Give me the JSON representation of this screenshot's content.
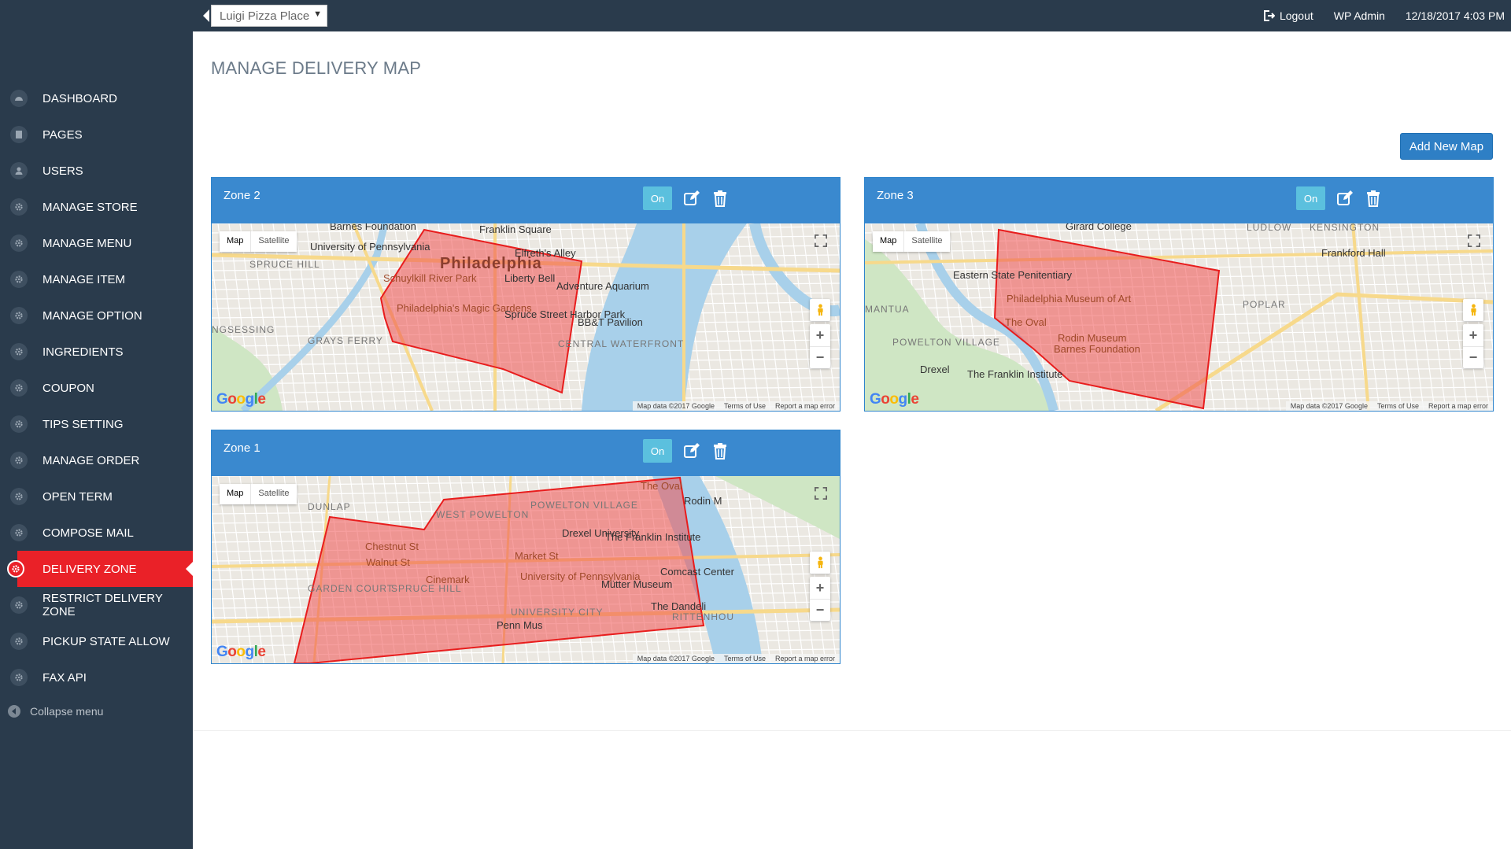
{
  "topbar": {
    "store_select": "Luigi Pizza Place",
    "logout": "Logout",
    "user": "WP Admin",
    "datetime": "12/18/2017 4:03 PM"
  },
  "sidebar": {
    "items": [
      {
        "label": "DASHBOARD",
        "icon": "dashboard-icon"
      },
      {
        "label": "PAGES",
        "icon": "pages-icon"
      },
      {
        "label": "USERS",
        "icon": "user-icon"
      },
      {
        "label": "MANAGE STORE",
        "icon": "gear-icon"
      },
      {
        "label": "MANAGE MENU",
        "icon": "gear-icon"
      },
      {
        "label": "MANAGE ITEM",
        "icon": "gear-icon"
      },
      {
        "label": "MANAGE OPTION",
        "icon": "gear-icon"
      },
      {
        "label": "INGREDIENTS",
        "icon": "gear-icon"
      },
      {
        "label": "COUPON",
        "icon": "gear-icon"
      },
      {
        "label": "TIPS SETTING",
        "icon": "gear-icon"
      },
      {
        "label": "MANAGE ORDER",
        "icon": "gear-icon"
      },
      {
        "label": "OPEN TERM",
        "icon": "gear-icon"
      },
      {
        "label": "COMPOSE MAIL",
        "icon": "gear-icon"
      },
      {
        "label": "DELIVERY ZONE",
        "icon": "gear-icon",
        "active": true
      },
      {
        "label": "RESTRICT DELIVERY ZONE",
        "icon": "gear-icon"
      },
      {
        "label": "PICKUP STATE ALLOW",
        "icon": "gear-icon"
      },
      {
        "label": "FAX API",
        "icon": "gear-icon"
      }
    ],
    "collapse_label": "Collapse menu"
  },
  "main": {
    "title": "MANAGE DELIVERY MAP",
    "add_button": "Add New Map"
  },
  "map_common": {
    "map_btn": "Map",
    "satellite_btn": "Satellite",
    "map_data": "Map data ©2017 Google",
    "terms": "Terms of Use",
    "report": "Report a map error",
    "zoom_in": "+",
    "zoom_out": "−"
  },
  "zones": [
    {
      "title": "Zone 2",
      "status": "On",
      "labels": {
        "city": "Philadelphia",
        "upenn": "University of Pennsylvania",
        "spruce_hill": "SPRUCE HILL",
        "schuylkill": "Schuylkill River Park",
        "magic": "Philadelphia's Magic Gardens",
        "liberty": "Liberty Bell",
        "elfreth": "Elfreth's Alley",
        "franklin": "Franklin Square",
        "aquarium": "Adventure Aquarium",
        "spruce_harbor": "Spruce Street Harbor Park",
        "bbt": "BB&T Pavilion",
        "central": "CENTRAL WATERFRONT",
        "grays": "GRAYS FERRY",
        "kingsessing": "NGSESSING",
        "barnes": "Barnes Foundation"
      }
    },
    {
      "title": "Zone 3",
      "status": "On",
      "labels": {
        "girard": "Girard College",
        "ludlow": "LUDLOW",
        "kensington": "KENSINGTON",
        "eastern": "Eastern State Penitentiary",
        "museum": "Philadelphia Museum of Art",
        "oval": "The Oval",
        "rodin": "Rodin Museum",
        "barnes": "Barnes Foundation",
        "frankford": "Frankford Hall",
        "poplar": "POPLAR",
        "powelton": "POWELTON VILLAGE",
        "mantua": "MANTUA",
        "drexel": "Drexel",
        "franklin_inst": "The Franklin Institute"
      }
    },
    {
      "title": "Zone 1",
      "status": "On",
      "labels": {
        "dunlap": "DUNLAP",
        "west_powelton": "WEST POWELTON",
        "powelton": "POWELTON VILLAGE",
        "drexel": "Drexel University",
        "oval": "The Oval",
        "rodin": "Rodin M",
        "franklin_inst": "The Franklin Institute",
        "chestnut": "Chestnut St",
        "walnut": "Walnut St",
        "market": "Market St",
        "cinemark": "Cinemark",
        "upenn": "University of Pennsylvania",
        "garden_court": "GARDEN COURT",
        "spruce_hill": "SPRUCE HILL",
        "mutter": "Mütter Museum",
        "comcast": "Comcast Center",
        "dandelion": "The Dandeli",
        "rittenhouse": "RITTENHOU",
        "university_city": "UNIVERSITY CITY",
        "penn_mus": "Penn Mus"
      }
    }
  ]
}
